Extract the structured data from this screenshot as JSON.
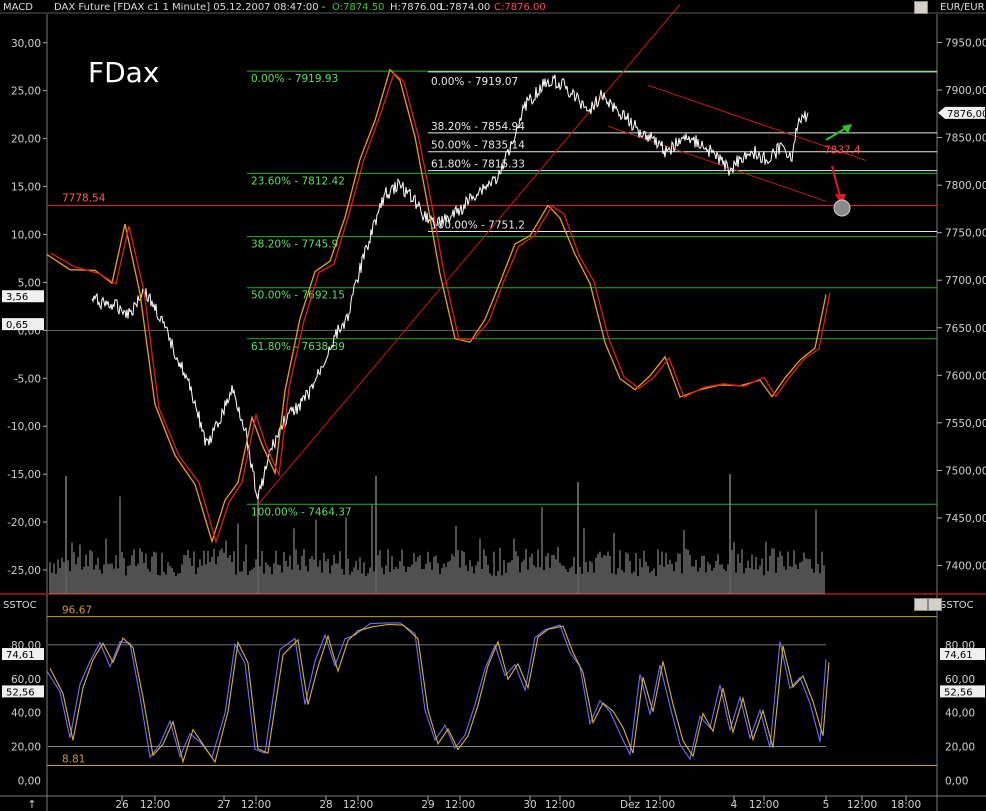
{
  "window": {
    "top_left_label": "MACD",
    "title": "DAX Future [FDAX c1  1 Minute] 05.12.2007 08:47:00 -",
    "ohlc": {
      "o": "O:7874.50",
      "h": "H:7876.00",
      "l": "L:7874.00",
      "c": "C:7876.00"
    },
    "currency": "EUR/EUR",
    "sstoc_left": "SSTOC",
    "sstoc_right": "SSTOC",
    "bottom_left_arrow": "↑"
  },
  "chart_data": [
    {
      "type": "line",
      "title": "FDax",
      "instrument": "DAX Future [FDAX c1 1 Minute]",
      "price_axis": {
        "unit": "EUR/EUR",
        "ylim": [
          7370,
          7980
        ],
        "ticks": [
          "7950,000",
          "7900,000",
          "7850,000",
          "7800,000",
          "7750,000",
          "7700,000",
          "7650,000",
          "7600,000",
          "7550,000",
          "7500,000",
          "7450,000",
          "7400,000"
        ],
        "last_value_tag": "7876,00"
      },
      "macd_axis": {
        "ylim": [
          -27.5,
          33
        ],
        "ticks": [
          "30,00",
          "25,00",
          "20,00",
          "15,00",
          "10,00",
          "5,00",
          "0,00",
          "-5,00",
          "-10,00",
          "-15,00",
          "-20,00",
          "-25,00"
        ],
        "value_tags": [
          "3,56",
          "0,65"
        ]
      },
      "x_axis": {
        "ticks": [
          "26",
          "12:00",
          "27",
          "12:00",
          "28",
          "12:00",
          "29",
          "12:00",
          "30",
          "12:00",
          "Dez",
          "12:00",
          "4",
          "12:00",
          "5",
          "12:00",
          "18:00"
        ]
      },
      "fib_left": [
        {
          "label": "0.00% - 7919.93",
          "value": 7919.93
        },
        {
          "label": "23.60% - 7812.42",
          "value": 7812.42
        },
        {
          "label": "38.20% - 7745.9",
          "value": 7745.9
        },
        {
          "label": "50.00% - 7692.15",
          "value": 7692.15
        },
        {
          "label": "61.80% - 7638.39",
          "value": 7638.39
        },
        {
          "label": "100.00% - 7464.37",
          "value": 7464.37
        }
      ],
      "fib_right": [
        {
          "label": "0.00% - 7919.07",
          "value": 7919.07
        },
        {
          "label": "38.20% - 7854.94",
          "value": 7854.94
        },
        {
          "label": "50.00% - 7835.14",
          "value": 7835.14
        },
        {
          "label": "61.80% - 7815.33",
          "value": 7815.33
        },
        {
          "label": "100.00% - 7751.2",
          "value": 7751.2
        }
      ],
      "horizontal_level": {
        "label": "7778.54",
        "value": 7778.54
      },
      "channel_label": "7837.4",
      "price_series": [
        [
          "26 00:00",
          7680
        ],
        [
          "26 06:00",
          7672
        ],
        [
          "26 09:00",
          7665
        ],
        [
          "26 12:00",
          7690
        ],
        [
          "26 15:00",
          7670
        ],
        [
          "26 18:00",
          7640
        ],
        [
          "26 21:00",
          7610
        ],
        [
          "27 00:00",
          7575
        ],
        [
          "27 03:00",
          7525
        ],
        [
          "27 06:00",
          7552
        ],
        [
          "27 09:00",
          7585
        ],
        [
          "27 12:00",
          7545
        ],
        [
          "27 15:00",
          7470
        ],
        [
          "27 18:00",
          7520
        ],
        [
          "27 21:00",
          7550
        ],
        [
          "28 00:00",
          7565
        ],
        [
          "28 03:00",
          7580
        ],
        [
          "28 06:00",
          7608
        ],
        [
          "28 09:00",
          7640
        ],
        [
          "28 12:00",
          7660
        ],
        [
          "28 15:00",
          7710
        ],
        [
          "28 18:00",
          7755
        ],
        [
          "28 21:00",
          7790
        ],
        [
          "29 00:00",
          7800
        ],
        [
          "29 03:00",
          7790
        ],
        [
          "29 06:00",
          7770
        ],
        [
          "29 09:00",
          7760
        ],
        [
          "29 12:00",
          7765
        ],
        [
          "29 15:00",
          7775
        ],
        [
          "29 18:00",
          7790
        ],
        [
          "29 21:00",
          7800
        ],
        [
          "30 00:00",
          7810
        ],
        [
          "30 03:00",
          7850
        ],
        [
          "30 06:00",
          7885
        ],
        [
          "30 09:00",
          7900
        ],
        [
          "30 12:00",
          7912
        ],
        [
          "30 15:00",
          7905
        ],
        [
          "30 18:00",
          7890
        ],
        [
          "30 21:00",
          7880
        ],
        [
          "Dez 00:00",
          7895
        ],
        [
          "Dez 03:00",
          7880
        ],
        [
          "Dez 06:00",
          7870
        ],
        [
          "Dez 09:00",
          7855
        ],
        [
          "Dez 12:00",
          7850
        ],
        [
          "Dez 15:00",
          7835
        ],
        [
          "Dez 18:00",
          7845
        ],
        [
          "Dez 21:00",
          7850
        ],
        [
          "4 00:00",
          7840
        ],
        [
          "4 03:00",
          7830
        ],
        [
          "4 06:00",
          7815
        ],
        [
          "4 09:00",
          7830
        ],
        [
          "4 12:00",
          7835
        ],
        [
          "4 15:00",
          7825
        ],
        [
          "4 18:00",
          7840
        ],
        [
          "4 21:00",
          7830
        ],
        [
          "5 00:00",
          7860
        ],
        [
          "5 03:00",
          7876
        ]
      ],
      "annotations": [
        "green arrow up",
        "red arrow down",
        "grey target circle"
      ]
    },
    {
      "type": "line",
      "title": "SSTOC",
      "ylim": [
        -8,
        100
      ],
      "ticks": [
        "80,00",
        "60,00",
        "40,00",
        "20,00",
        "0,00"
      ],
      "value_tags": [
        "74,61",
        "52,56"
      ],
      "bands": [
        {
          "label": "96.67",
          "value": 96.67
        },
        {
          "label": "8.81",
          "value": 8.81
        }
      ],
      "ref_lines": [
        80,
        20
      ]
    }
  ],
  "colors": {
    "background": "#000000",
    "grid": "#3a3a3a",
    "fib": "#1fb41f",
    "fib_text": "#5ce05c",
    "level": "#d22323",
    "price": "#ffffff",
    "macd_fast": "#e5a317",
    "macd_slow": "#e01a1a",
    "stoc_fast": "#6d6dff",
    "stoc_slow": "#d8b22e",
    "band": "#c89a2c",
    "volume": "#bdbdbd"
  }
}
